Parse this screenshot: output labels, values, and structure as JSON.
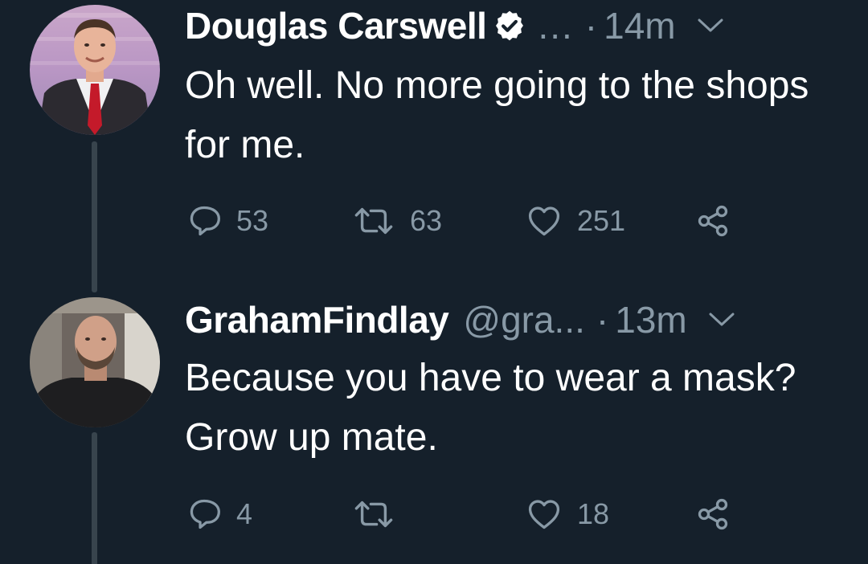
{
  "tweets": [
    {
      "display_name": "Douglas Carswell",
      "verified": true,
      "handle": "...",
      "separator": "·",
      "time": "14m",
      "text": "Oh well.  No more going to the shops for me.",
      "replies": "53",
      "retweets": "63",
      "likes": "251",
      "icons": [
        "reply-icon",
        "retweet-icon",
        "like-icon",
        "share-icon",
        "chevron-down-icon",
        "verified-badge-icon"
      ]
    },
    {
      "display_name": "GrahamFindlay",
      "verified": false,
      "handle": "@gra...",
      "separator": "·",
      "time": "13m",
      "text": "Because you have to wear a mask? Grow up mate.",
      "replies": "4",
      "retweets": "",
      "likes": "18",
      "icons": [
        "reply-icon",
        "retweet-icon",
        "like-icon",
        "share-icon",
        "chevron-down-icon"
      ]
    }
  ],
  "colors": {
    "background": "#15202b",
    "primary_text": "#ffffff",
    "secondary_text": "#8899a6",
    "thread_line": "#38444d"
  }
}
